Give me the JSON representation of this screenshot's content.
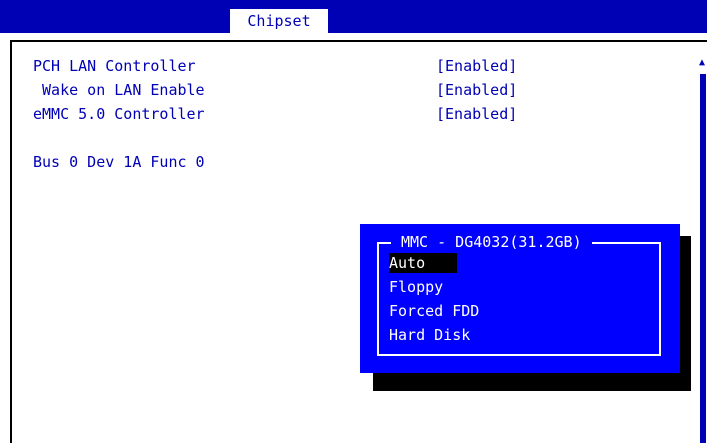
{
  "header": {
    "tab_label": "Chipset"
  },
  "settings": [
    {
      "label": "PCH LAN Controller",
      "value": "[Enabled]"
    },
    {
      "label": " Wake on LAN Enable",
      "value": "[Enabled]"
    },
    {
      "label": "eMMC 5.0 Controller",
      "value": "[Enabled]"
    },
    {
      "label": "Bus 0 Dev 1A Func 0",
      "value": ""
    },
    {
      "label": "MMC - DG4032(31.2GB)",
      "value": "[Auto]"
    }
  ],
  "popup": {
    "title": "MMC - DG4032(31.2GB)",
    "options": [
      "Auto",
      "Floppy",
      "Forced FDD",
      "Hard Disk"
    ],
    "selected": "Auto"
  },
  "scrollbar": {
    "up_icon": "triangle-up-icon"
  },
  "colors": {
    "accent_blue": "#0000b5",
    "popup_blue": "#0000ff",
    "shadow": "#000000",
    "text_white": "#ffffff"
  }
}
